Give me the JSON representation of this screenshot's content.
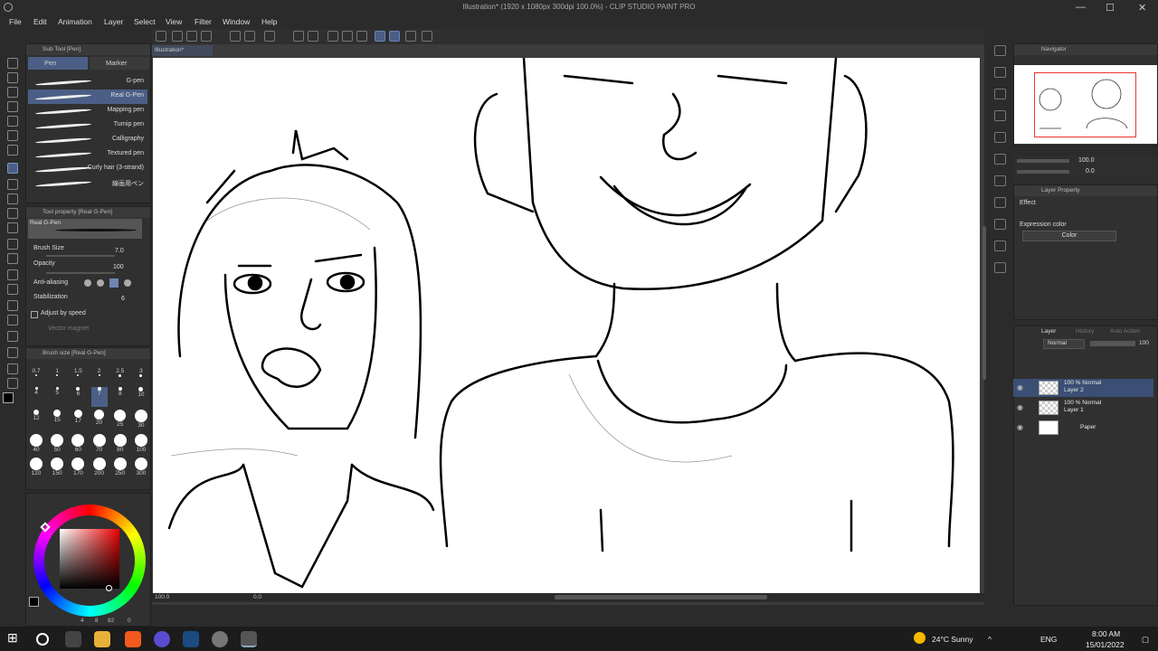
{
  "window": {
    "title": "Illustration* (1920 x 1080px 300dpi 100.0%) - CLIP STUDIO PAINT PRO",
    "minimize": "—",
    "maximize": "☐",
    "close": "✕"
  },
  "menu": [
    "File",
    "Edit",
    "Animation",
    "Layer",
    "Select",
    "View",
    "Filter",
    "Window",
    "Help"
  ],
  "document_tab": "Illustration*",
  "subtool": {
    "panel_title": "Sub Tool [Pen]",
    "tabs": [
      "Pen",
      "Marker"
    ],
    "brushes": [
      "G-pen",
      "Real G-Pen",
      "Mapping pen",
      "Turnip pen",
      "Calligraphy",
      "Textured pen",
      "Curly hair (3-strand)",
      "線画用ペン"
    ],
    "selected_brush": "Real G-Pen"
  },
  "tool_property": {
    "title": "Tool property [Real G-Pen]",
    "preview_label": "Real G-Pen",
    "brush_size_label": "Brush Size",
    "brush_size": "7.0",
    "opacity_label": "Opacity",
    "opacity": "100",
    "antialias_label": "Anti-aliasing",
    "stabilization_label": "Stabilization",
    "stabilization": "6",
    "adjust_speed_label": "Adjust by speed",
    "vector_magnet_label": "Vector magnet"
  },
  "brush_size_panel": {
    "title": "Brush size [Real G-Pen]",
    "row1": [
      "0.7",
      "1",
      "1.5",
      "2",
      "2.5",
      "3"
    ],
    "row2": [
      "4",
      "5",
      "6",
      "7",
      "8",
      "10"
    ],
    "row3": [
      "12",
      "15",
      "17",
      "20",
      "25",
      "30"
    ],
    "row4": [
      "40",
      "50",
      "60",
      "70",
      "80",
      "100"
    ],
    "row5": [
      "120",
      "150",
      "170",
      "200",
      "250",
      "300"
    ],
    "selected": "7"
  },
  "color": {
    "main": "#000000",
    "sub": "#ffffff",
    "bottom_values": [
      "4",
      "8",
      "82",
      "0"
    ]
  },
  "status": {
    "zoom": "100.0",
    "angle": "0.0"
  },
  "navigator": {
    "title": "Navigator",
    "zoom": "100.0",
    "rotation": "0.0"
  },
  "layer_property": {
    "title": "Layer Property",
    "effect_label": "Effect",
    "expression_color_label": "Expression color",
    "expression_color": "Color"
  },
  "layer_panel": {
    "tabs": [
      "Layer",
      "History",
      "Auto Action"
    ],
    "blend_mode": "Normal",
    "opacity": "100",
    "layers": [
      {
        "mode": "100 % Normal",
        "name": "Layer 2",
        "selected": true
      },
      {
        "mode": "100 % Normal",
        "name": "Layer 1",
        "selected": false
      },
      {
        "mode": "",
        "name": "Paper",
        "selected": false
      }
    ]
  },
  "taskbar": {
    "weather": "24°C  Sunny",
    "lang": "ENG",
    "time": "8:00 AM",
    "date": "15/01/2022"
  },
  "accent": "#4b5f86"
}
